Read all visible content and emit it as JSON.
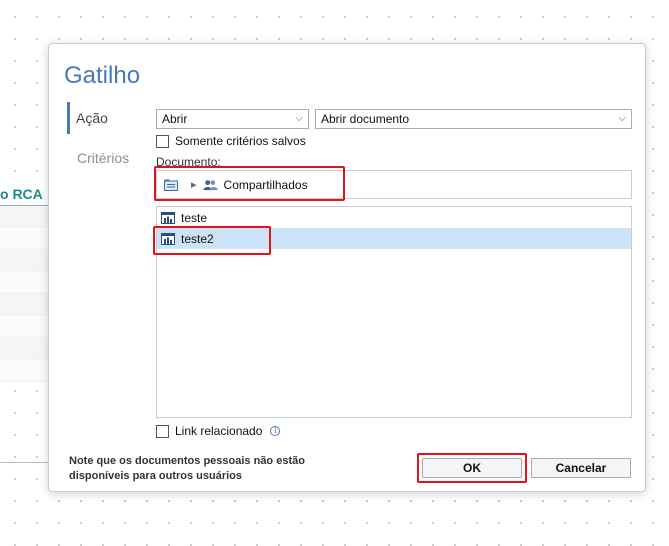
{
  "background": {
    "column_header": "o RCA"
  },
  "dialog": {
    "title": "Gatilho",
    "nav": {
      "action": "Ação",
      "criteria": "Critérios"
    },
    "action_select": "Abrir",
    "target_select": "Abrir documento",
    "saved_criteria_only_label": "Somente critérios salvos",
    "document_label": "Documento:",
    "breadcrumb": {
      "location": "Compartilhados"
    },
    "documents": [
      {
        "name": "teste",
        "selected": false
      },
      {
        "name": "teste2",
        "selected": true
      }
    ],
    "related_link_label": "Link relacionado",
    "note": "Note que os documentos pessoais não estão disponíveis para outros usuários",
    "ok_label": "OK",
    "cancel_label": "Cancelar"
  },
  "colors": {
    "accent": "#4a78b5",
    "highlight": "#e0141e",
    "selection": "#cce3f7"
  }
}
